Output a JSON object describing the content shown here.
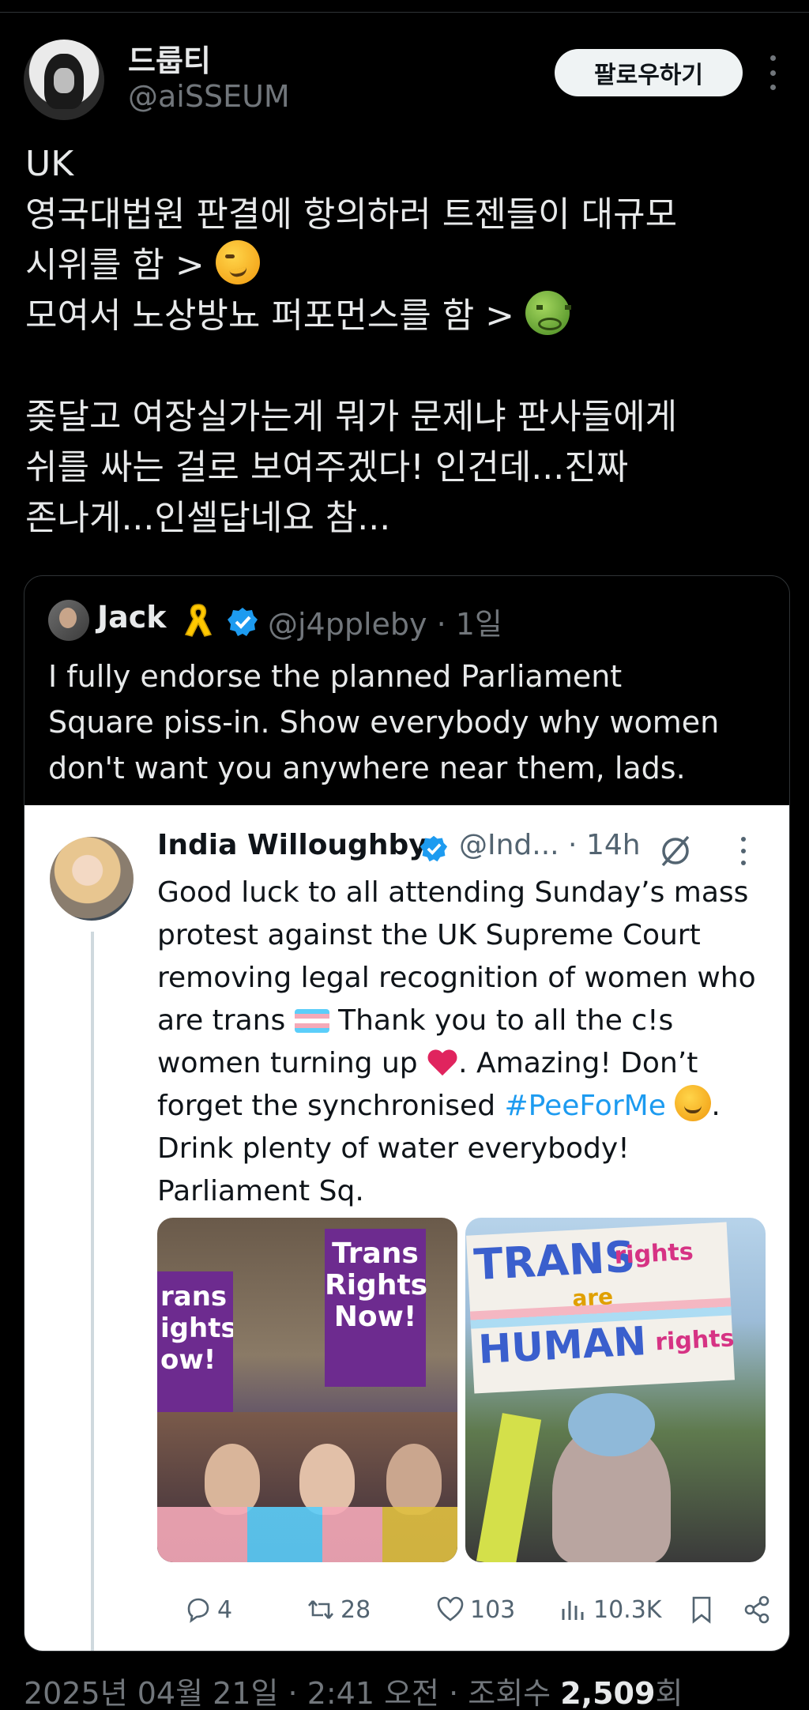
{
  "author": {
    "display_name": "드룹티",
    "handle": "@aiSSEUM",
    "follow_label": "팔로우하기"
  },
  "tweet": {
    "lines": [
      "UK",
      "영국대법원 판결에 항의하러 트젠들이 대규모",
      "시위를 함 > ",
      "모여서 노상방뇨 퍼포먼스를 함 > ",
      "",
      "좆달고 여장실가는게 뭐가 문제냐 판사들에게",
      "쉬를 싸는 걸로 보여주겠다! 인건데...진짜",
      "존나게...인셀답네요 참..."
    ],
    "emoji_1": "smirking-face",
    "emoji_2": "nauseated-face"
  },
  "quote": {
    "name": "Jack",
    "handle_time": "@j4ppleby · 1일",
    "lines": [
      "I fully endorse the planned Parliament",
      "Square piss-in. Show everybody why women",
      "don't want you anywhere near them, lads."
    ],
    "icons": [
      "yellow-ribbon-icon",
      "verified-badge-icon"
    ],
    "embedded": {
      "name": "India Willoughby",
      "handle_time": "@Ind... · 14h",
      "lines": [
        "Good luck to all attending Sunday’s mass",
        "protest against the UK Supreme Court",
        "removing legal recognition of women who",
        "are trans",
        "Thank you to all the c!s",
        "women turning up",
        ". Amazing! Don’t",
        "forget the synchronised",
        "#PeeForMe",
        ".",
        "Drink plenty of water everybody!",
        "Parliament Sq."
      ],
      "photo_left_signs": [
        "Trans Rights Now!",
        "rans ights ow!"
      ],
      "photo_right_sign": {
        "w1": "TRANS",
        "w2": "rights",
        "w3": "are",
        "w4": "HUMAN",
        "w5": "rights"
      },
      "stats": {
        "replies": "4",
        "retweets": "28",
        "likes": "103",
        "views": "10.3K"
      }
    }
  },
  "footer": {
    "date_time": "2025년 04월 21일 · 2:41 오전 · 조회수 ",
    "views_count": "2,509",
    "views_suffix": "회"
  },
  "colors": {
    "background": "#000000",
    "text": "#e7e9ea",
    "muted": "#71767b",
    "verified": "#1d9bf0",
    "hashtag": "#1d9bf0"
  }
}
